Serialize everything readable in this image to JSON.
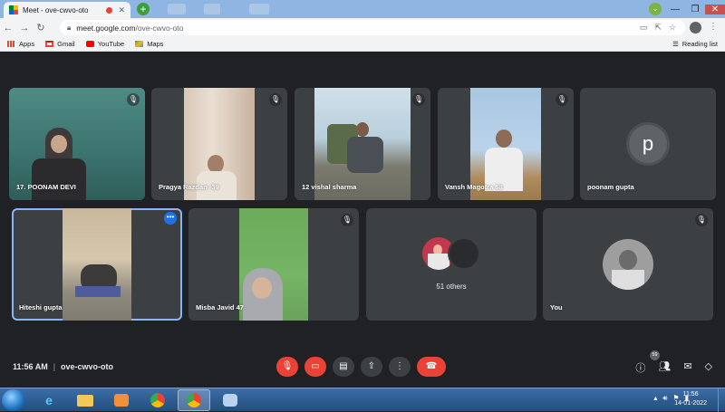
{
  "browser": {
    "tab_title": "Meet - ove-cwvo-oto",
    "url_host": "meet.google.com",
    "url_path": "/ove-cwvo-oto",
    "bookmarks": [
      {
        "label": "Apps",
        "icon": "apps-grid-icon"
      },
      {
        "label": "Gmail",
        "icon": "gmail-icon"
      },
      {
        "label": "YouTube",
        "icon": "youtube-icon"
      },
      {
        "label": "Maps",
        "icon": "maps-icon"
      }
    ],
    "reading_list": "Reading list"
  },
  "meet": {
    "tiles_row1": [
      {
        "name": "17. POONAM DEVI"
      },
      {
        "name": "Pragya Razdan -39"
      },
      {
        "name": "12 vishal sharma"
      },
      {
        "name": "Vansh Magotra 58"
      },
      {
        "name": "poonam gupta",
        "avatar_letter": "p"
      }
    ],
    "tiles_row2": [
      {
        "name": "Hiteshi gupta"
      },
      {
        "name": "Misba Javid 47"
      },
      {
        "name": "51 others"
      },
      {
        "name": "You"
      }
    ],
    "time": "11:56 AM",
    "meeting_code": "ove-cwvo-oto",
    "participants_count": "59"
  },
  "taskbar": {
    "time": "11:56",
    "date": "14-01-2022"
  },
  "colors": {
    "background": "#202124",
    "tile": "#3c4043",
    "red": "#ea4335",
    "selected_outline": "#8ab4f8"
  }
}
